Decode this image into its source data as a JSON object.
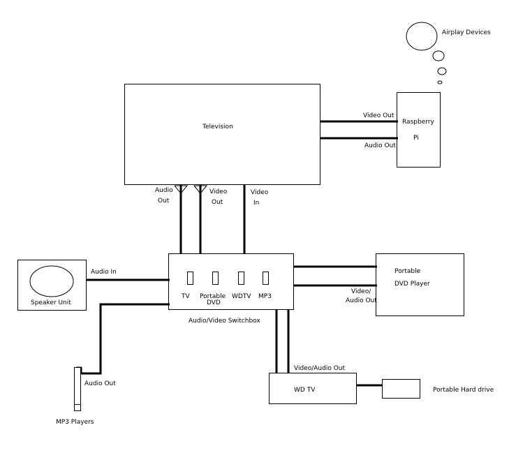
{
  "diagram": {
    "nodes": {
      "airplay": {
        "label": "Airplay Devices"
      },
      "television": {
        "label": "Television"
      },
      "raspberry_pi": {
        "label_line1": "Raspberry",
        "label_line2": "Pi"
      },
      "switchbox": {
        "label": "Audio/Video Switchbox",
        "ports": [
          {
            "label_line1": "TV",
            "label_line2": ""
          },
          {
            "label_line1": "Portable",
            "label_line2": "DVD"
          },
          {
            "label_line1": "WDTV",
            "label_line2": ""
          },
          {
            "label_line1": "MP3",
            "label_line2": ""
          }
        ]
      },
      "speaker": {
        "label": "Speaker Unit"
      },
      "portable_dvd": {
        "label_line1": "Portable",
        "label_line2": "DVD Player"
      },
      "wdtv": {
        "label": "WD TV"
      },
      "hard_drive": {
        "label": "Portable Hard drive"
      },
      "mp3": {
        "label": "MP3 Players"
      }
    },
    "connections": {
      "pi_video_out": "Video Out",
      "pi_audio_out": "Audio Out",
      "tv_audio_out_line1": "Audio",
      "tv_audio_out_line2": "Out",
      "tv_video_out_line1": "Video",
      "tv_video_out_line2": "Out",
      "tv_video_in_line1": "Video",
      "tv_video_in_line2": "In",
      "speaker_audio_in": "Audio In",
      "dvd_out_line1": "Video/",
      "dvd_out_line2": "Audio Out",
      "wdtv_out": "Video/Audio Out",
      "mp3_audio_out": "Audio Out"
    }
  }
}
